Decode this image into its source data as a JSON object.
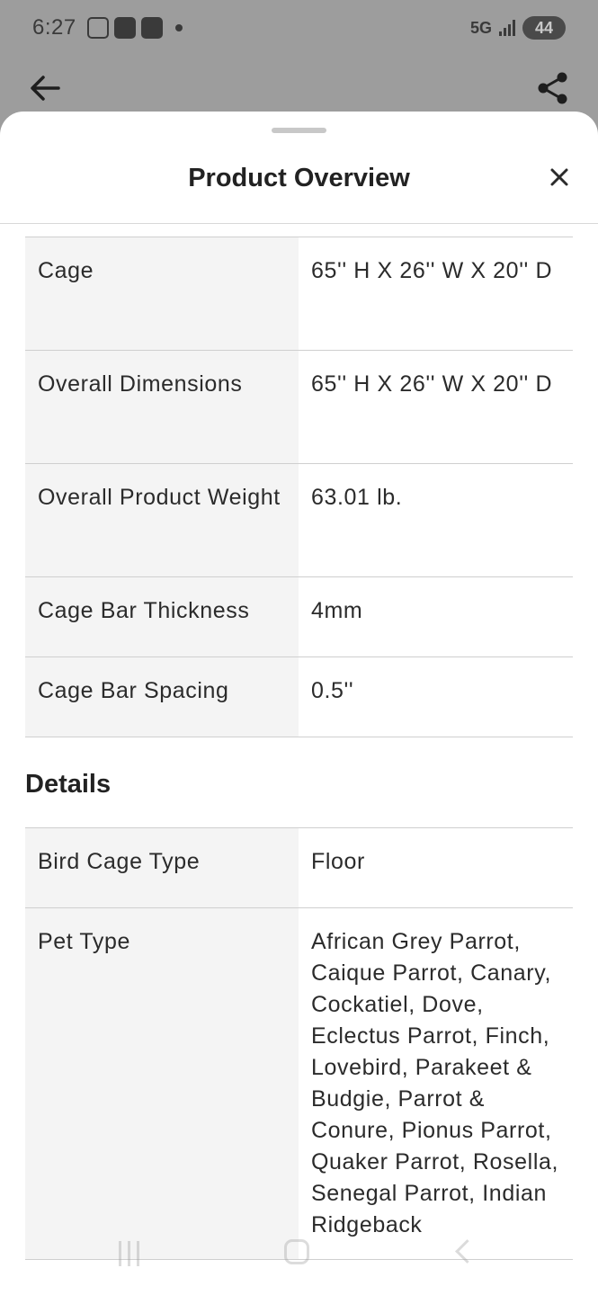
{
  "status_bar": {
    "time": "6:27",
    "network": "5G",
    "battery": "44"
  },
  "sheet": {
    "title": "Product Overview"
  },
  "dimensions_rows": [
    {
      "label": "Cage",
      "value": "65'' H X 26'' W X 20'' D"
    },
    {
      "label": "Overall Dimensions",
      "value": "65'' H X 26'' W X 20'' D"
    },
    {
      "label": "Overall Product Weight",
      "value": "63.01 lb."
    },
    {
      "label": "Cage Bar Thickness",
      "value": "4mm"
    },
    {
      "label": "Cage Bar Spacing",
      "value": "0.5''"
    }
  ],
  "details": {
    "heading": "Details",
    "rows": [
      {
        "label": "Bird Cage Type",
        "value": "Floor"
      },
      {
        "label": "Pet Type",
        "value": "African Grey Parrot, Caique Parrot, Canary, Cockatiel, Dove, Eclectus Parrot, Finch, Lovebird, Parakeet & Budgie, Parrot & Conure, Pionus Parrot, Quaker Parrot, Rosella, Senegal Parrot, Indian Ridgeback"
      }
    ]
  },
  "icons": {
    "back": "arrow-left-icon",
    "share": "share-icon",
    "close": "close-icon"
  }
}
